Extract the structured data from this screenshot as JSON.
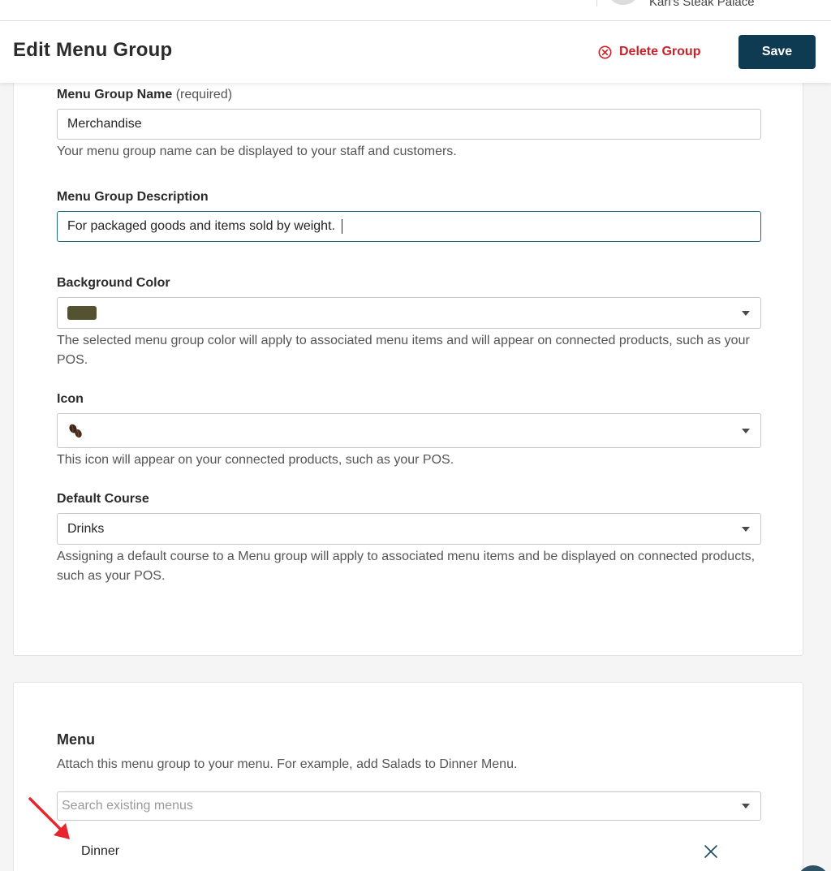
{
  "topbar": {
    "restaurant_name": "Kari's Steak Palace"
  },
  "header": {
    "title": "Edit Menu Group",
    "delete_label": "Delete Group",
    "save_label": "Save"
  },
  "form": {
    "name": {
      "label": "Menu Group Name",
      "required_hint": "(required)",
      "value": "Merchandise",
      "help": "Your menu group name can be displayed to your staff and customers."
    },
    "description": {
      "label": "Menu Group Description",
      "value": "For packaged goods and items sold by weight."
    },
    "background_color": {
      "label": "Background Color",
      "selected_color": "#545231",
      "help": "The selected menu group color will apply to associated menu items and will appear on connected products, such as your POS."
    },
    "icon": {
      "label": "Icon",
      "selected_icon": "coffee-beans-icon",
      "help": "This icon will appear on your connected products, such as your POS."
    },
    "default_course": {
      "label": "Default Course",
      "value": "Drinks",
      "help": "Assigning a default course to a Menu group will apply to associated menu items and be displayed on connected products, such as your POS."
    }
  },
  "menu_section": {
    "title": "Menu",
    "help": "Attach this menu group to your menu. For example, add Salads to Dinner Menu.",
    "search_placeholder": "Search existing menus",
    "attached_menus": [
      {
        "name": "Dinner"
      }
    ]
  },
  "colors": {
    "primary": "#0e3a52",
    "danger": "#c9222a",
    "focus_border": "#1e6b80",
    "annotation_arrow": "#e8252f"
  }
}
